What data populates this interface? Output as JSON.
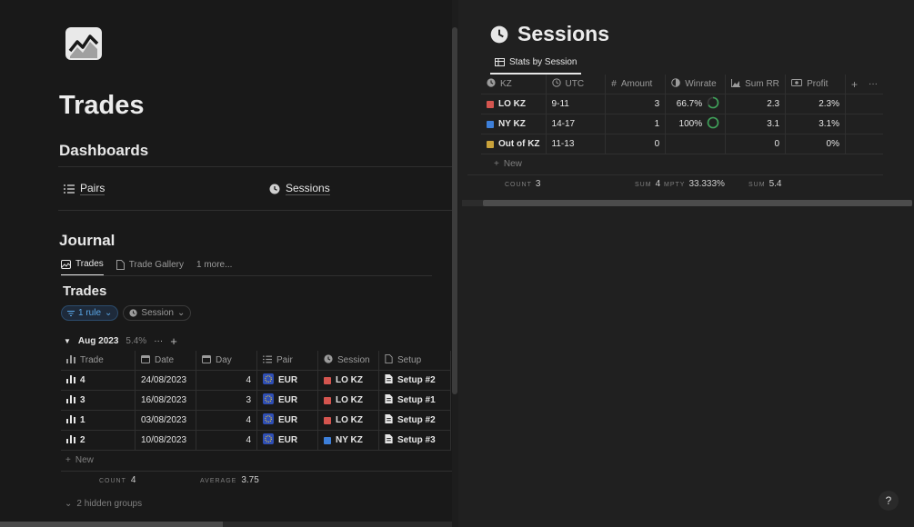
{
  "left": {
    "page_title": "Trades",
    "dashboards_heading": "Dashboards",
    "links": [
      {
        "label": "Pairs",
        "icon": "list-icon"
      },
      {
        "label": "Sessions",
        "icon": "clock-icon"
      }
    ],
    "journal_heading": "Journal",
    "tabs": [
      {
        "label": "Trades",
        "icon": "gallery-icon",
        "active": true
      },
      {
        "label": "Trade Gallery",
        "icon": "document-icon",
        "active": false
      },
      {
        "label": "1 more...",
        "icon": "",
        "active": false
      }
    ],
    "view_title": "Trades",
    "filter_rule": "1 rule",
    "filter_session": "Session",
    "group": {
      "label": "Aug 2023",
      "pct": "5.4%"
    },
    "columns": [
      "Trade",
      "Date",
      "Day",
      "Pair",
      "Session",
      "Setup"
    ],
    "rows": [
      {
        "trade": "4",
        "date": "24/08/2023",
        "day": "4",
        "pair": "EUR",
        "session": "LO KZ",
        "session_color": "#d4554f",
        "setup": "Setup #2"
      },
      {
        "trade": "3",
        "date": "16/08/2023",
        "day": "3",
        "pair": "EUR",
        "session": "LO KZ",
        "session_color": "#d4554f",
        "setup": "Setup #1"
      },
      {
        "trade": "1",
        "date": "03/08/2023",
        "day": "4",
        "pair": "EUR",
        "session": "LO KZ",
        "session_color": "#d4554f",
        "setup": "Setup #2"
      },
      {
        "trade": "2",
        "date": "10/08/2023",
        "day": "4",
        "pair": "EUR",
        "session": "NY KZ",
        "session_color": "#3d7fd9",
        "setup": "Setup #3"
      }
    ],
    "new_label": "New",
    "footer": {
      "count_label": "COUNT",
      "count_value": "4",
      "avg_label": "AVERAGE",
      "avg_value": "3.75"
    },
    "hidden_groups": "2 hidden groups"
  },
  "right": {
    "title": "Sessions",
    "tab": "Stats by Session",
    "columns": [
      "KZ",
      "UTC",
      "Amount",
      "Winrate",
      "Sum RR",
      "Profit"
    ],
    "rows": [
      {
        "kz": "LO KZ",
        "color": "#d4554f",
        "utc": "9-11",
        "amount": "3",
        "winrate": "66.7%",
        "winrate_frac": 0.667,
        "sum_rr": "2.3",
        "profit": "2.3%"
      },
      {
        "kz": "NY KZ",
        "color": "#3d7fd9",
        "utc": "14-17",
        "amount": "1",
        "winrate": "100%",
        "winrate_frac": 1.0,
        "sum_rr": "3.1",
        "profit": "3.1%"
      },
      {
        "kz": "Out of KZ",
        "color": "#c9a23a",
        "utc": "11-13",
        "amount": "0",
        "winrate": "",
        "winrate_frac": null,
        "sum_rr": "0",
        "profit": "0%"
      }
    ],
    "new_label": "New",
    "footer": {
      "count_label": "COUNT",
      "count_value": "3",
      "sum_label": "SUM",
      "sum_value": "4",
      "empty_label": "MPTY",
      "empty_value": "33.333%",
      "rr_label": "SUM",
      "rr_value": "5.4"
    },
    "help": "?",
    "accent_green": "#3fa35a"
  }
}
